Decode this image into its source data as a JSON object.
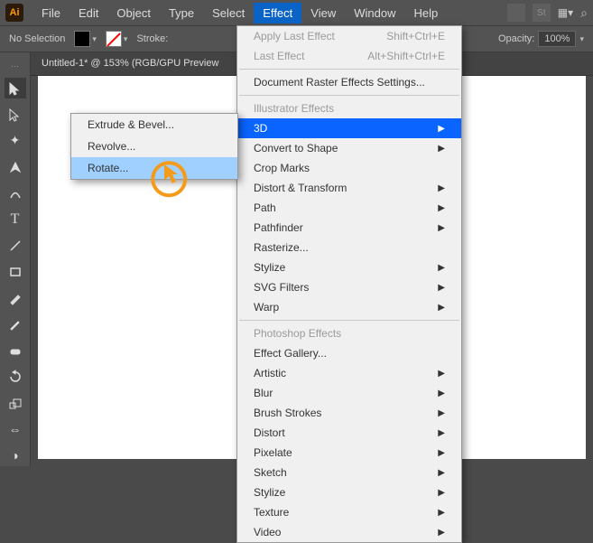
{
  "app": {
    "logo": "Ai"
  },
  "menu": [
    "File",
    "Edit",
    "Object",
    "Type",
    "Select",
    "Effect",
    "View",
    "Window",
    "Help"
  ],
  "menu_active_index": 5,
  "optionsbar": {
    "selection": "No Selection",
    "stroke_label": "Stroke:",
    "opacity_label": "Opacity:",
    "opacity_value": "100%"
  },
  "doc": {
    "tab": "Untitled-1* @ 153% (RGB/GPU Preview"
  },
  "effect_menu": {
    "apply_last": "Apply Last Effect",
    "apply_last_key": "Shift+Ctrl+E",
    "last": "Last Effect",
    "last_key": "Alt+Shift+Ctrl+E",
    "raster_settings": "Document Raster Effects Settings...",
    "ill_heading": "Illustrator Effects",
    "items_ill": [
      {
        "label": "3D",
        "arrow": true,
        "highlight": true
      },
      {
        "label": "Convert to Shape",
        "arrow": true
      },
      {
        "label": "Crop Marks",
        "arrow": false
      },
      {
        "label": "Distort & Transform",
        "arrow": true
      },
      {
        "label": "Path",
        "arrow": true
      },
      {
        "label": "Pathfinder",
        "arrow": true
      },
      {
        "label": "Rasterize...",
        "arrow": false
      },
      {
        "label": "Stylize",
        "arrow": true
      },
      {
        "label": "SVG Filters",
        "arrow": true
      },
      {
        "label": "Warp",
        "arrow": true
      }
    ],
    "ps_heading": "Photoshop Effects",
    "items_ps": [
      {
        "label": "Effect Gallery...",
        "arrow": false
      },
      {
        "label": "Artistic",
        "arrow": true
      },
      {
        "label": "Blur",
        "arrow": true
      },
      {
        "label": "Brush Strokes",
        "arrow": true
      },
      {
        "label": "Distort",
        "arrow": true
      },
      {
        "label": "Pixelate",
        "arrow": true
      },
      {
        "label": "Sketch",
        "arrow": true
      },
      {
        "label": "Stylize",
        "arrow": true
      },
      {
        "label": "Texture",
        "arrow": true
      },
      {
        "label": "Video",
        "arrow": true
      }
    ]
  },
  "submenu_3d": {
    "items": [
      {
        "label": "Extrude & Bevel...",
        "hl": false
      },
      {
        "label": "Revolve...",
        "hl": false
      },
      {
        "label": "Rotate...",
        "hl": true
      }
    ]
  },
  "tools": [
    "selection",
    "direct-select",
    "pen",
    "curvature",
    "type",
    "line",
    "rectangle",
    "brush",
    "pencil",
    "eraser",
    "rotate",
    "scale"
  ]
}
